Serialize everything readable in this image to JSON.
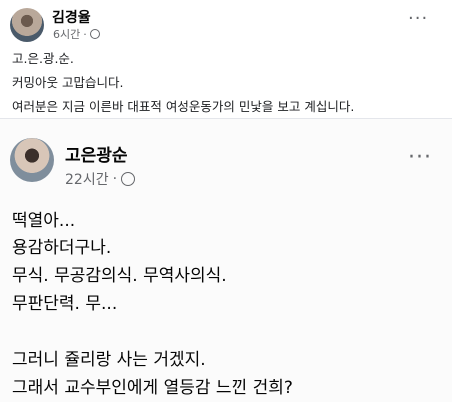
{
  "post": {
    "author": "김경율",
    "time": "6시간",
    "time_sep": "·",
    "lines": [
      "고.은.광.순.",
      "커밍아웃 고맙습니다.",
      "여러분은 지금 이른바 대표적 여성운동가의 민낯을 보고 계십니다."
    ]
  },
  "shared": {
    "author": "고은광순",
    "time": "22시간",
    "time_sep": "·",
    "lines": [
      "떡열아...",
      "용감하더구나.",
      "무식. 무공감의식. 무역사의식.",
      "무판단력. 무...",
      "",
      "그러니 쥴리랑 사는 거겠지.",
      "그래서 교수부인에게 열등감 느낀 건희?"
    ]
  },
  "icons": {
    "more": "more-options-icon",
    "globe": "globe-icon"
  },
  "more_glyph": "···"
}
